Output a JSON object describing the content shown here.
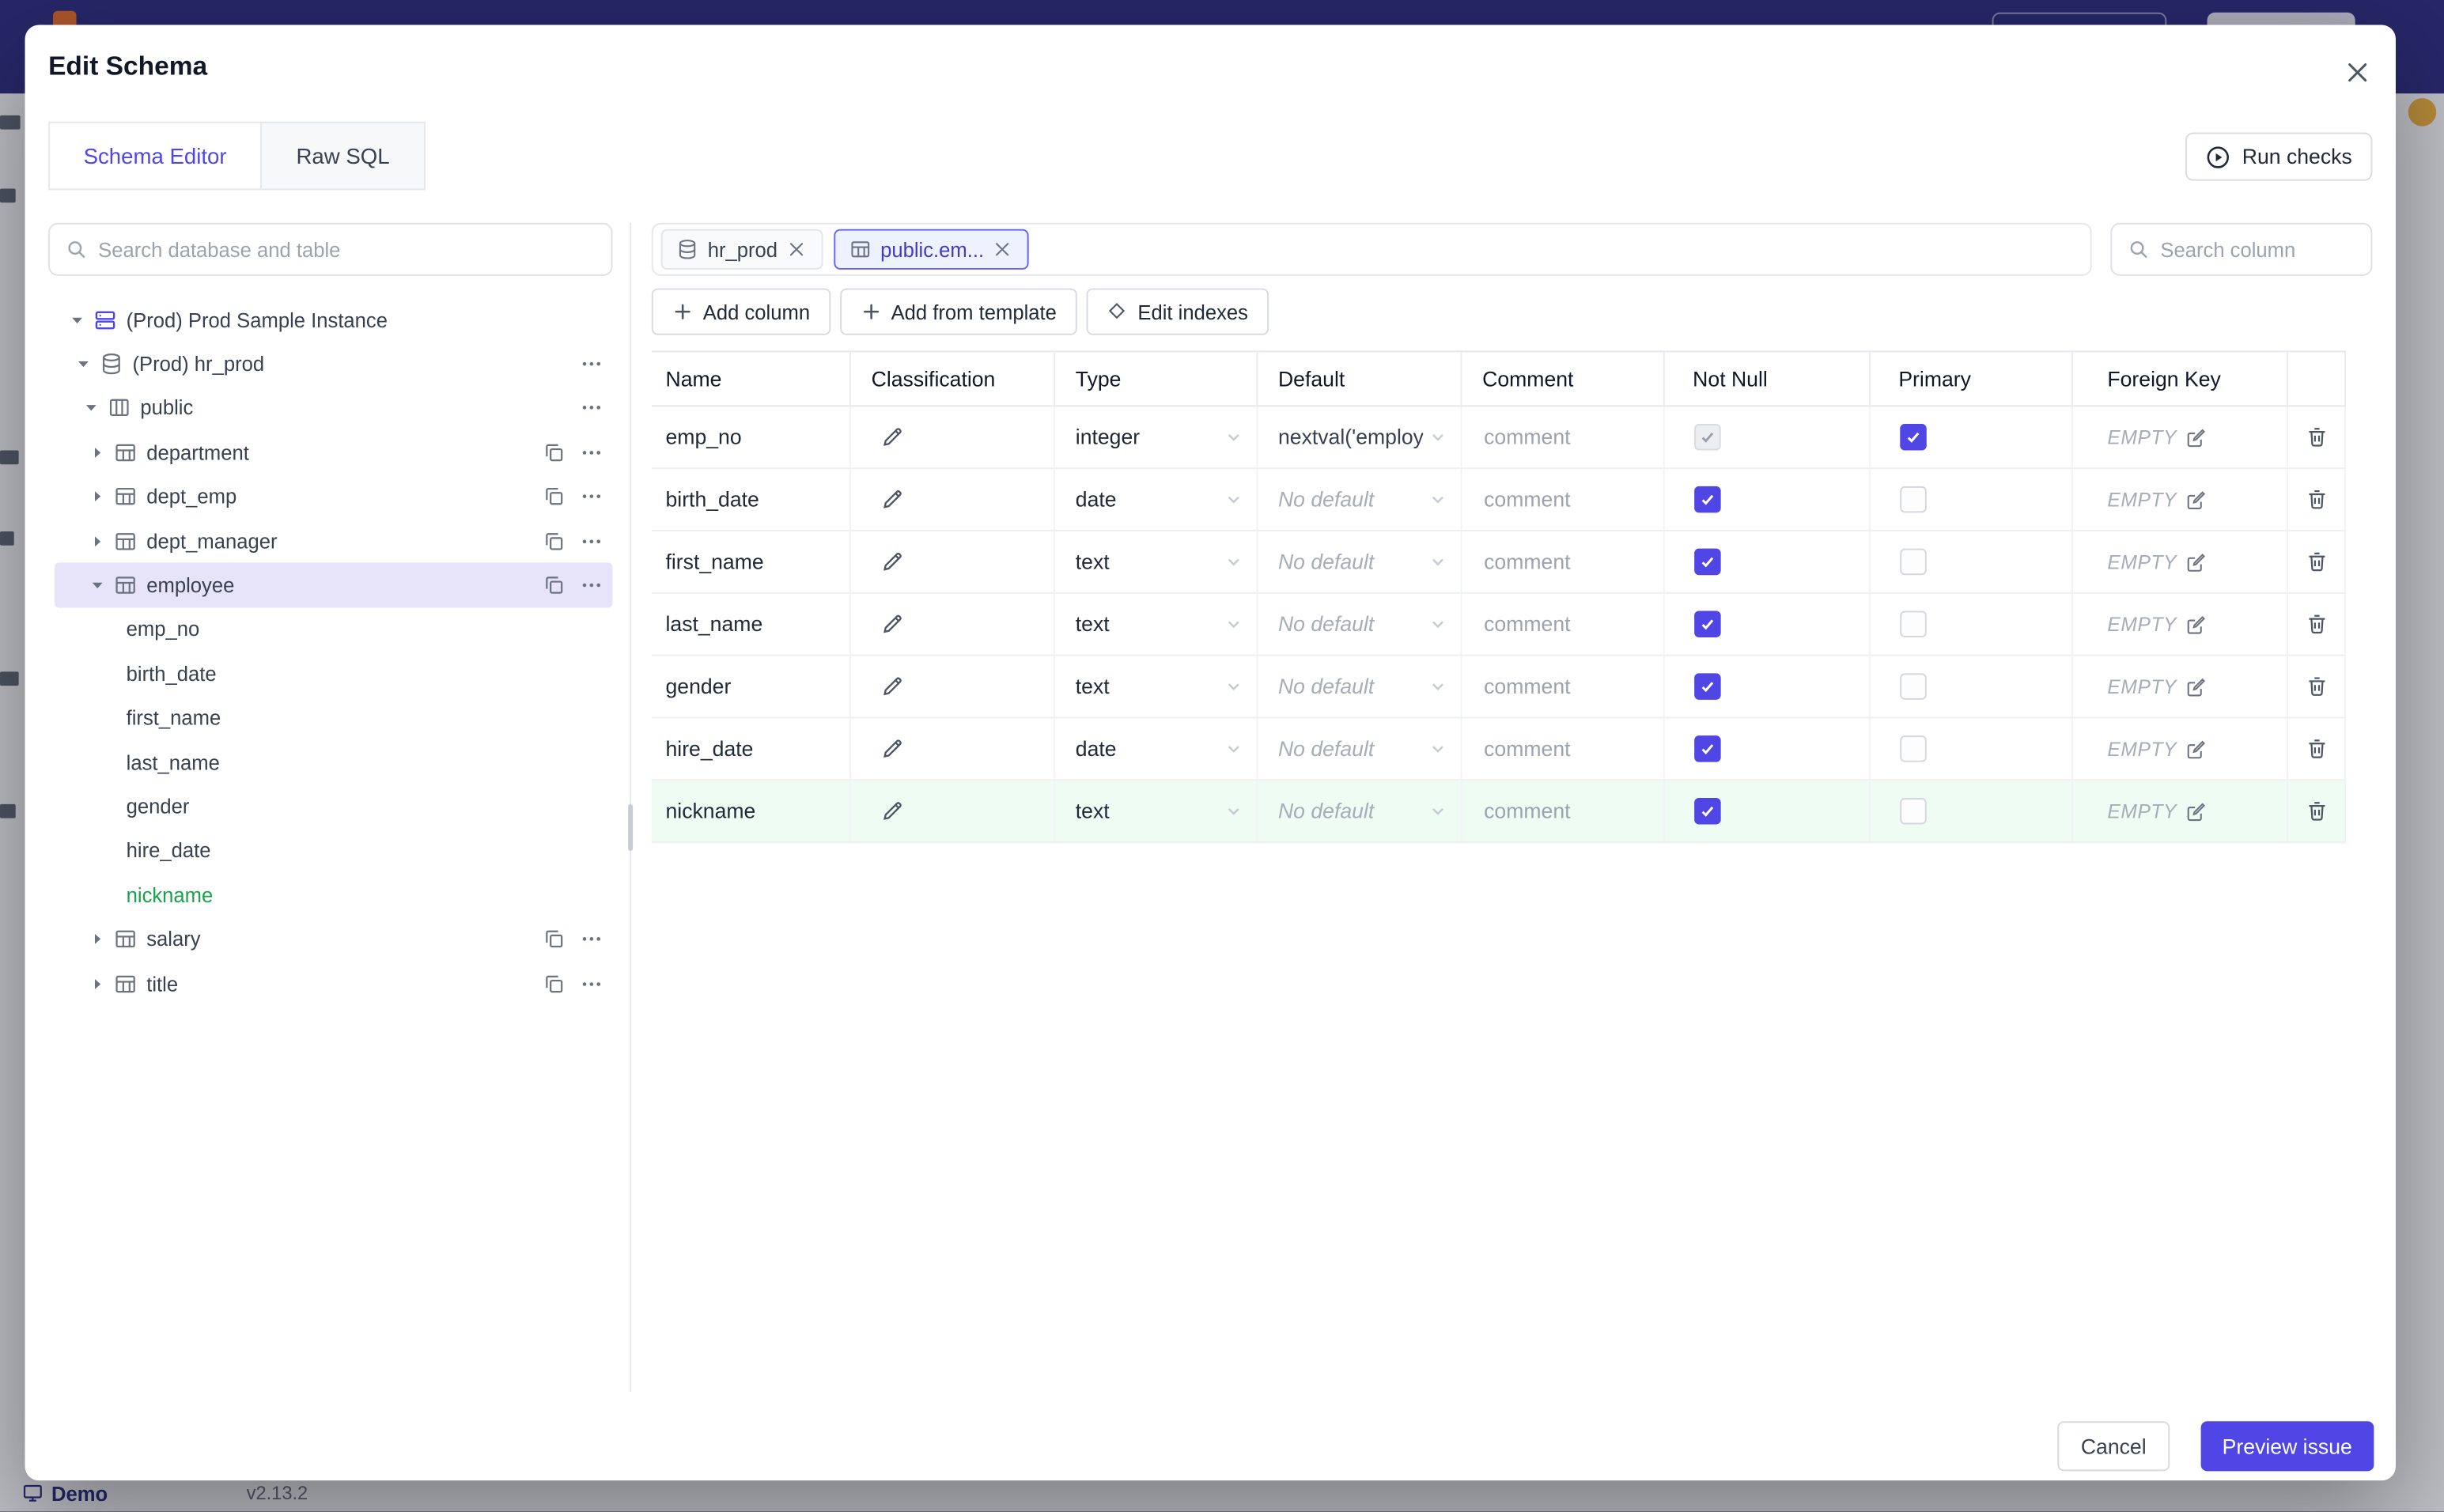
{
  "colors": {
    "accent": "#4F46E5",
    "topbar": "#312E81",
    "new_item_green": "#16A34A",
    "selected_tree_bg": "#E7E4F9",
    "new_row_bg": "#EFFCF4"
  },
  "background": {
    "demo_label": "Demo",
    "version": "v2.13.2"
  },
  "modal": {
    "title": "Edit Schema",
    "tabs": [
      {
        "label": "Schema Editor",
        "active": true
      },
      {
        "label": "Raw SQL",
        "active": false
      }
    ],
    "run_checks_label": "Run checks"
  },
  "sidebar": {
    "search_placeholder": "Search database and table",
    "tree": [
      {
        "label": "(Prod) Prod Sample Instance",
        "type": "instance",
        "expanded": true
      },
      {
        "label": "(Prod) hr_prod",
        "type": "database",
        "expanded": true
      },
      {
        "label": "public",
        "type": "schema",
        "expanded": true
      },
      {
        "label": "department",
        "type": "table",
        "expanded": false
      },
      {
        "label": "dept_emp",
        "type": "table",
        "expanded": false
      },
      {
        "label": "dept_manager",
        "type": "table",
        "expanded": false
      },
      {
        "label": "employee",
        "type": "table",
        "expanded": true,
        "selected": true
      },
      {
        "label": "emp_no",
        "type": "column"
      },
      {
        "label": "birth_date",
        "type": "column"
      },
      {
        "label": "first_name",
        "type": "column"
      },
      {
        "label": "last_name",
        "type": "column"
      },
      {
        "label": "gender",
        "type": "column"
      },
      {
        "label": "hire_date",
        "type": "column"
      },
      {
        "label": "nickname",
        "type": "column",
        "new": true
      },
      {
        "label": "salary",
        "type": "table",
        "expanded": false
      },
      {
        "label": "title",
        "type": "table",
        "expanded": false
      }
    ]
  },
  "editor": {
    "chips": [
      {
        "label": "hr_prod",
        "type": "database"
      },
      {
        "label": "public.em...",
        "type": "table",
        "selected": true
      }
    ],
    "search_placeholder": "Search column",
    "actions": {
      "add_column": "Add column",
      "add_template": "Add from template",
      "edit_indexes": "Edit indexes"
    },
    "table": {
      "headers": [
        "Name",
        "Classification",
        "Type",
        "Default",
        "Comment",
        "Not Null",
        "Primary",
        "Foreign Key"
      ],
      "comment_placeholder": "comment",
      "fk_empty": "EMPTY",
      "rows": [
        {
          "name": "emp_no",
          "type": "integer",
          "default": "nextval('employ",
          "not_null": "checked-disabled",
          "primary": true,
          "new": false
        },
        {
          "name": "birth_date",
          "type": "date",
          "default": "No default",
          "not_null": true,
          "primary": false,
          "new": false
        },
        {
          "name": "first_name",
          "type": "text",
          "default": "No default",
          "not_null": true,
          "primary": false,
          "new": false
        },
        {
          "name": "last_name",
          "type": "text",
          "default": "No default",
          "not_null": true,
          "primary": false,
          "new": false
        },
        {
          "name": "gender",
          "type": "text",
          "default": "No default",
          "not_null": true,
          "primary": false,
          "new": false
        },
        {
          "name": "hire_date",
          "type": "date",
          "default": "No default",
          "not_null": true,
          "primary": false,
          "new": false
        },
        {
          "name": "nickname",
          "type": "text",
          "default": "No default",
          "not_null": true,
          "primary": false,
          "new": true
        }
      ]
    },
    "footer": {
      "cancel": "Cancel",
      "preview": "Preview issue"
    }
  }
}
